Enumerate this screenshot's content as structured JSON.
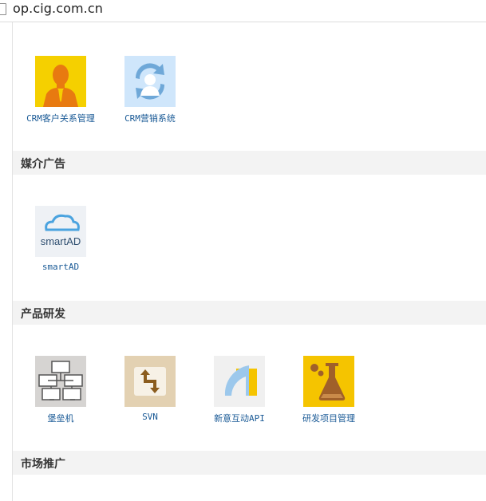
{
  "browser": {
    "url": "op.cig.com.cn"
  },
  "sections": [
    {
      "title": "媒介广告"
    },
    {
      "title": "产品研发"
    },
    {
      "title": "市场推广"
    }
  ],
  "top_apps": [
    {
      "label": "CRM客户关系管理",
      "icon": "person-icon"
    },
    {
      "label": "CRM营销系统",
      "icon": "people-exchange-icon"
    }
  ],
  "media_apps": [
    {
      "label": "smartAD",
      "icon": "smartad-cloud-icon",
      "logo_text": "smartAD"
    }
  ],
  "dev_apps": [
    {
      "label": "堡垒机",
      "icon": "network-computers-icon"
    },
    {
      "label": "SVN",
      "icon": "svn-arrows-icon"
    },
    {
      "label": "新意互动API",
      "icon": "api-shape-icon"
    },
    {
      "label": "研发项目管理",
      "icon": "lab-flask-icon"
    }
  ],
  "colors": {
    "label": "#1a5a96",
    "section_bg": "#f3f3f3",
    "crm_yellow": "#f5d000",
    "crm_marketing_bg": "#cfe6fb",
    "smartad_bg": "#eef1f5",
    "bastion_bg": "#d6d4d2",
    "svn_bg": "#e3d1b2",
    "api_bg": "#f0f0f0",
    "flask_bg": "#f5c400"
  }
}
